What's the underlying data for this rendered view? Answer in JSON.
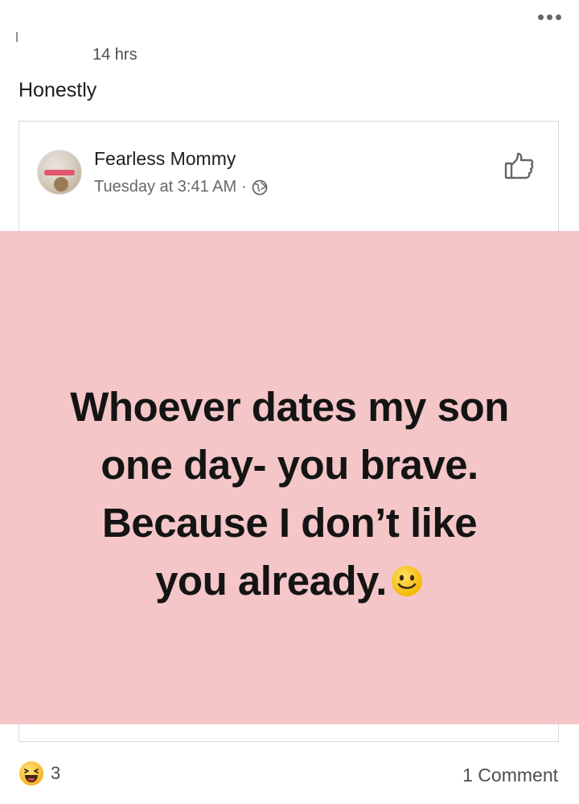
{
  "post": {
    "time": "14 hrs",
    "caption": "Honestly"
  },
  "shared_post": {
    "author": "Fearless Mommy",
    "timestamp": "Tuesday at 3:41 AM",
    "separator": "·",
    "privacy_icon": "globe-icon",
    "image_text_lines": [
      "Whoever dates my son",
      "one day- you brave.",
      "Because I don’t like",
      "you already."
    ],
    "image_background": "#f4c6c8"
  },
  "footer": {
    "reaction_icon": "haha-icon",
    "reaction_count": "3",
    "comments": "1 Comment"
  }
}
